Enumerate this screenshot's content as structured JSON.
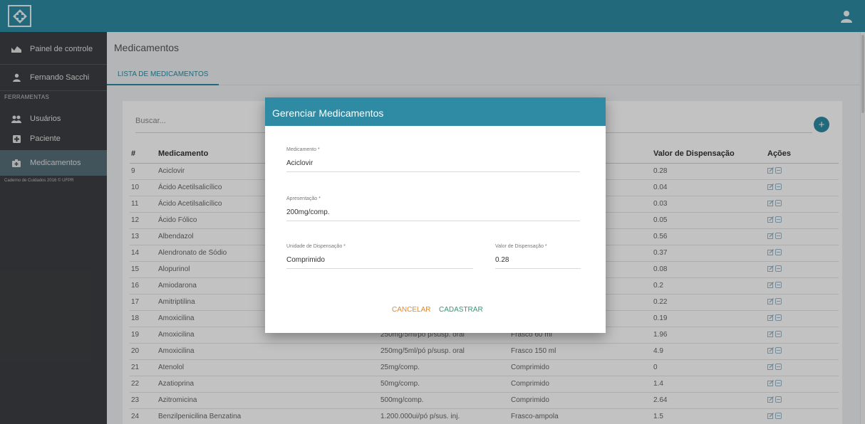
{
  "sidebar": {
    "dashboard": "Painel de controle",
    "user": "Fernando Sacchi",
    "section": "FERRAMENTAS",
    "usuarios": "Usuários",
    "paciente": "Paciente",
    "medicamentos": "Medicamentos",
    "footer": "Caderno de Cuidados 2016 © UFPR"
  },
  "page": {
    "title": "Medicamentos",
    "tab": "LISTA DE MEDICAMENTOS",
    "search_placeholder": "Buscar..."
  },
  "table": {
    "headers": [
      "#",
      "Medicamento",
      "",
      "",
      "Valor de Dispensação",
      "Ações"
    ],
    "rows": [
      {
        "id": "9",
        "name": "Aciclovir",
        "pres": "",
        "unit": "",
        "value": "0.28"
      },
      {
        "id": "10",
        "name": "Ácido Acetilsalicílico",
        "pres": "",
        "unit": "",
        "value": "0.04"
      },
      {
        "id": "11",
        "name": "Ácido Acetilsalicílico",
        "pres": "",
        "unit": "",
        "value": "0.03"
      },
      {
        "id": "12",
        "name": "Ácido Fólico",
        "pres": "",
        "unit": "",
        "value": "0.05"
      },
      {
        "id": "13",
        "name": "Albendazol",
        "pres": "",
        "unit": "",
        "value": "0.56"
      },
      {
        "id": "14",
        "name": "Alendronato de Sódio",
        "pres": "",
        "unit": "",
        "value": "0.37"
      },
      {
        "id": "15",
        "name": "Alopurinol",
        "pres": "",
        "unit": "",
        "value": "0.08"
      },
      {
        "id": "16",
        "name": "Amiodarona",
        "pres": "",
        "unit": "",
        "value": "0.2"
      },
      {
        "id": "17",
        "name": "Amitriptilina",
        "pres": "",
        "unit": "",
        "value": "0.22"
      },
      {
        "id": "18",
        "name": "Amoxicilina",
        "pres": "",
        "unit": "",
        "value": "0.19"
      },
      {
        "id": "19",
        "name": "Amoxicilina",
        "pres": "250mg/5ml/pó p/susp. oral",
        "unit": "Frasco 60 ml",
        "value": "1.96"
      },
      {
        "id": "20",
        "name": "Amoxicilina",
        "pres": "250mg/5ml/pó p/susp. oral",
        "unit": "Frasco 150 ml",
        "value": "4.9"
      },
      {
        "id": "21",
        "name": "Atenolol",
        "pres": "25mg/comp.",
        "unit": "Comprimido",
        "value": "0"
      },
      {
        "id": "22",
        "name": "Azatioprina",
        "pres": "50mg/comp.",
        "unit": "Comprimido",
        "value": "1.4"
      },
      {
        "id": "23",
        "name": "Azitromicina",
        "pres": "500mg/comp.",
        "unit": "Comprimido",
        "value": "2.64"
      },
      {
        "id": "24",
        "name": "Benzilpenicilina Benzatina",
        "pres": "1.200.000ui/pó p/sus. inj.",
        "unit": "Frasco-ampola",
        "value": "1.5"
      }
    ]
  },
  "modal": {
    "title": "Gerenciar Medicamentos",
    "med_label": "Medicamento *",
    "med_value": "Aciclovir",
    "pres_label": "Apresentação *",
    "pres_value": "200mg/comp.",
    "unit_label": "Unidade de Dispensação *",
    "unit_value": "Comprimido",
    "valor_label": "Valor de Dispensação *",
    "valor_value": "0.28",
    "cancel": "CANCELAR",
    "save": "CADASTRAR"
  },
  "colors": {
    "primary": "#2f8aa3",
    "sidebar": "#3d3f42",
    "cancel": "#e08a2b",
    "save": "#2f9a7a"
  }
}
